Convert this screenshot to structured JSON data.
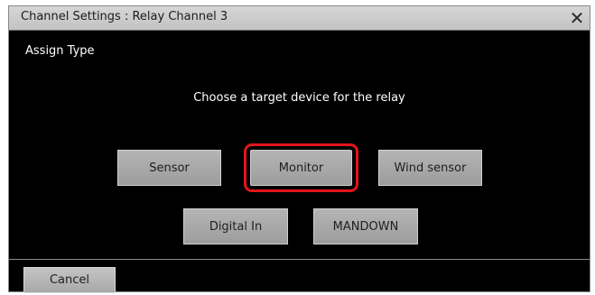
{
  "window": {
    "title": "Channel Settings : Relay Channel 3",
    "close_glyph": "✕",
    "close_icon": "close-icon"
  },
  "section": {
    "label": "Assign Type"
  },
  "prompt": "Choose a target device for the relay",
  "choices": {
    "sensor": "Sensor",
    "monitor": "Monitor",
    "wind_sensor": "Wind sensor",
    "digital_in": "Digital In",
    "mandown": "MANDOWN"
  },
  "selected_choice": "Monitor",
  "footer": {
    "cancel_label": "Cancel"
  },
  "colors": {
    "background": "#000000",
    "button": "#a9a9a9",
    "selection_outline": "#e1151a",
    "titlebar": "#cdcdcd"
  }
}
